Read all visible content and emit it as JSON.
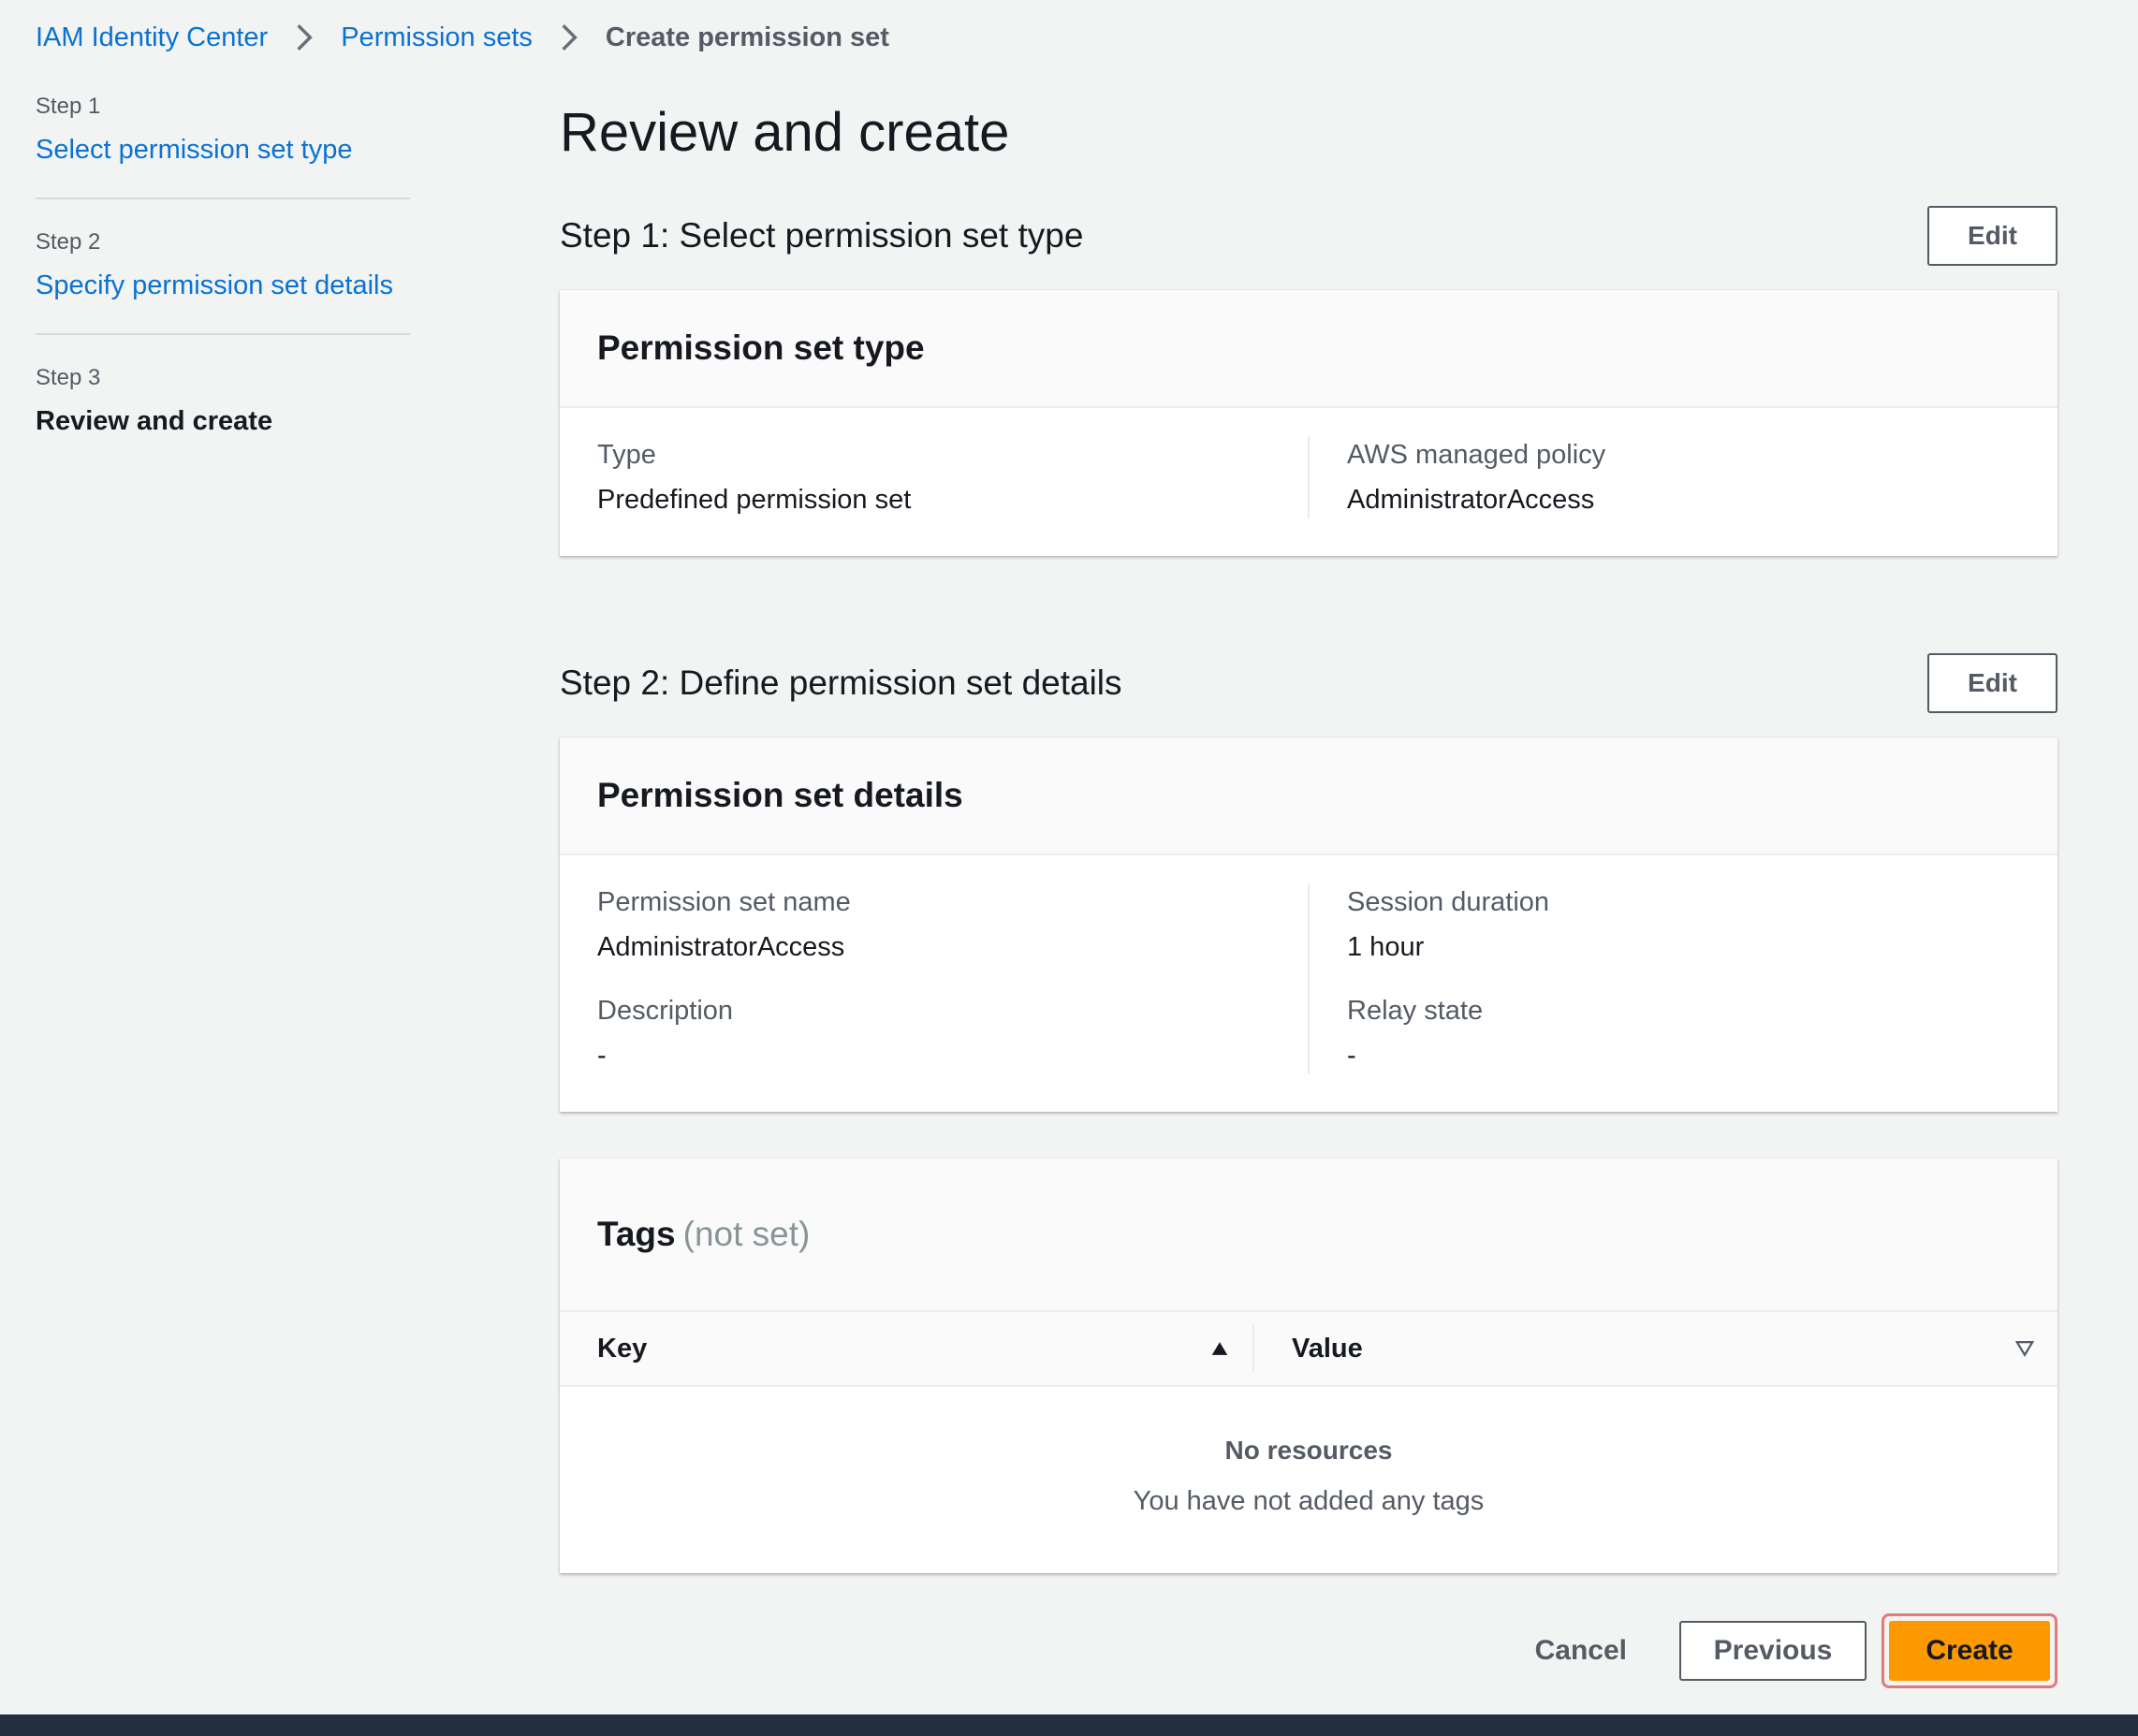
{
  "breadcrumb": {
    "items": [
      "IAM Identity Center",
      "Permission sets"
    ],
    "current": "Create permission set"
  },
  "steps": [
    {
      "number": "Step 1",
      "title": "Select permission set type"
    },
    {
      "number": "Step 2",
      "title": "Specify permission set details"
    },
    {
      "number": "Step 3",
      "title": "Review and create"
    }
  ],
  "page": {
    "title": "Review and create"
  },
  "section1": {
    "heading": "Step 1: Select permission set type",
    "edit_label": "Edit",
    "card_title": "Permission set type",
    "fields": {
      "type_label": "Type",
      "type_value": "Predefined permission set",
      "policy_label": "AWS managed policy",
      "policy_value": "AdministratorAccess"
    }
  },
  "section2": {
    "heading": "Step 2: Define permission set details",
    "edit_label": "Edit",
    "card_title": "Permission set details",
    "fields": {
      "name_label": "Permission set name",
      "name_value": "AdministratorAccess",
      "description_label": "Description",
      "description_value": "-",
      "duration_label": "Session duration",
      "duration_value": "1 hour",
      "relay_label": "Relay state",
      "relay_value": "-"
    }
  },
  "tags": {
    "title": "Tags",
    "suffix": "(not set)",
    "columns": [
      "Key",
      "Value"
    ],
    "empty_title": "No resources",
    "empty_message": "You have not added any tags"
  },
  "actions": {
    "cancel": "Cancel",
    "previous": "Previous",
    "create": "Create"
  },
  "colors": {
    "link": "#0972d3",
    "primary": "#ff9900",
    "background": "#f2f3f3",
    "footer_bar": "#232f3e"
  }
}
